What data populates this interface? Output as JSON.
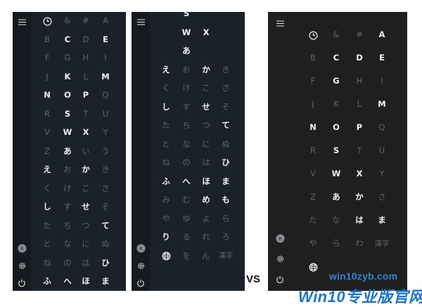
{
  "panels": [
    {
      "name": "panel-left",
      "bg": "#1b2129",
      "rail": "#151a21",
      "rail_icons": [
        {
          "name": "hamburger-menu-icon",
          "slot": "top"
        },
        {
          "name": "user-avatar-icon",
          "slot": "b3"
        },
        {
          "name": "settings-gear-icon",
          "slot": "b2"
        },
        {
          "name": "power-icon",
          "slot": "b1"
        }
      ],
      "rows": [
        [
          [
            "clock",
            1
          ],
          [
            "&",
            0
          ],
          [
            "#",
            0
          ],
          [
            "A",
            0
          ]
        ],
        [
          [
            "B",
            0
          ],
          [
            "C",
            1
          ],
          [
            "D",
            0
          ],
          [
            "E",
            1
          ]
        ],
        [
          [
            "F",
            0
          ],
          [
            "G",
            0
          ],
          [
            "H",
            0
          ],
          [
            "I",
            0
          ]
        ],
        [
          [
            "J",
            0
          ],
          [
            "K",
            1
          ],
          [
            "L",
            0
          ],
          [
            "M",
            1
          ]
        ],
        [
          [
            "N",
            1
          ],
          [
            "O",
            1
          ],
          [
            "P",
            1
          ],
          [
            "Q",
            0
          ]
        ],
        [
          [
            "R",
            0
          ],
          [
            "S",
            1
          ],
          [
            "T",
            0
          ],
          [
            "U",
            0
          ]
        ],
        [
          [
            "V",
            0
          ],
          [
            "W",
            1
          ],
          [
            "X",
            1
          ],
          [
            "Y",
            0
          ]
        ],
        [
          [
            "Z",
            0
          ],
          [
            "あ",
            1
          ],
          [
            "い",
            0
          ],
          [
            "う",
            0
          ]
        ],
        [
          [
            "え",
            1
          ],
          [
            "お",
            0
          ],
          [
            "か",
            1
          ],
          [
            "き",
            0
          ]
        ],
        [
          [
            "く",
            0
          ],
          [
            "け",
            0
          ],
          [
            "こ",
            0
          ],
          [
            "さ",
            0
          ]
        ],
        [
          [
            "し",
            1
          ],
          [
            "す",
            0
          ],
          [
            "せ",
            1
          ],
          [
            "そ",
            0
          ]
        ],
        [
          [
            "た",
            0
          ],
          [
            "ち",
            0
          ],
          [
            "つ",
            0
          ],
          [
            "て",
            1
          ]
        ],
        [
          [
            "と",
            0
          ],
          [
            "な",
            0
          ],
          [
            "に",
            0
          ],
          [
            "ぬ",
            0
          ]
        ],
        [
          [
            "ね",
            0
          ],
          [
            "の",
            0
          ],
          [
            "は",
            0
          ],
          [
            "ひ",
            1
          ]
        ],
        [
          [
            "ふ",
            1
          ],
          [
            "へ",
            1
          ],
          [
            "ほ",
            1
          ],
          [
            "ま",
            1
          ]
        ]
      ]
    },
    {
      "name": "panel-middle",
      "bg": "#1b2129",
      "rail": "#151a21",
      "rail_icons": [
        {
          "name": "hamburger-menu-icon",
          "slot": "top"
        },
        {
          "name": "user-avatar-icon",
          "slot": "b3"
        },
        {
          "name": "settings-gear-icon",
          "slot": "b2"
        },
        {
          "name": "power-icon",
          "slot": "b1"
        }
      ],
      "rows": [
        [
          [
            "",
            0
          ],
          [
            "S",
            1
          ],
          [
            "",
            0
          ],
          [
            "",
            0
          ]
        ],
        [
          [
            "",
            0
          ],
          [
            "W",
            1
          ],
          [
            "X",
            1
          ],
          [
            "",
            0
          ]
        ],
        [
          [
            "",
            0
          ],
          [
            "あ",
            1
          ],
          [
            "",
            0
          ],
          [
            "",
            0
          ]
        ],
        [
          [
            "え",
            1
          ],
          [
            "お",
            0
          ],
          [
            "か",
            1
          ],
          [
            "き",
            0
          ]
        ],
        [
          [
            "く",
            0
          ],
          [
            "け",
            0
          ],
          [
            "こ",
            0
          ],
          [
            "さ",
            0
          ]
        ],
        [
          [
            "し",
            1
          ],
          [
            "す",
            0
          ],
          [
            "せ",
            1
          ],
          [
            "そ",
            0
          ]
        ],
        [
          [
            "た",
            0
          ],
          [
            "ち",
            0
          ],
          [
            "つ",
            0
          ],
          [
            "て",
            1
          ]
        ],
        [
          [
            "と",
            0
          ],
          [
            "な",
            0
          ],
          [
            "に",
            0
          ],
          [
            "ぬ",
            0
          ]
        ],
        [
          [
            "ね",
            0
          ],
          [
            "の",
            0
          ],
          [
            "は",
            0
          ],
          [
            "ひ",
            1
          ]
        ],
        [
          [
            "ふ",
            1
          ],
          [
            "へ",
            1
          ],
          [
            "ほ",
            1
          ],
          [
            "ま",
            1
          ]
        ],
        [
          [
            "み",
            0
          ],
          [
            "む",
            0
          ],
          [
            "め",
            1
          ],
          [
            "も",
            1
          ]
        ],
        [
          [
            "や",
            0
          ],
          [
            "ゆ",
            0
          ],
          [
            "よ",
            0
          ],
          [
            "ら",
            0
          ]
        ],
        [
          [
            "り",
            1
          ],
          [
            "る",
            0
          ],
          [
            "れ",
            0
          ],
          [
            "ろ",
            0
          ]
        ],
        [
          [
            "globe",
            1
          ],
          [
            "を",
            0
          ],
          [
            "ん",
            0
          ],
          [
            "漢字",
            0
          ]
        ]
      ]
    },
    {
      "name": "panel-right",
      "bg": "#1f1f1f",
      "rail": "#1f1f1f",
      "rail_icons": [
        {
          "name": "hamburger-menu-icon",
          "slot": "top"
        },
        {
          "name": "user-avatar-icon",
          "slot": "b3"
        },
        {
          "name": "settings-gear-icon",
          "slot": "b2"
        },
        {
          "name": "power-icon",
          "slot": "b1"
        }
      ],
      "rows": [
        [
          [
            "clock",
            1
          ],
          [
            "&",
            0
          ],
          [
            "#",
            0
          ],
          [
            "A",
            1
          ]
        ],
        [
          [
            "B",
            0
          ],
          [
            "C",
            1
          ],
          [
            "D",
            1
          ],
          [
            "E",
            1
          ]
        ],
        [
          [
            "F",
            0
          ],
          [
            "G",
            1
          ],
          [
            "H",
            0
          ],
          [
            "I",
            0
          ]
        ],
        [
          [
            "J",
            0
          ],
          [
            "K",
            0
          ],
          [
            "L",
            0
          ],
          [
            "M",
            1
          ]
        ],
        [
          [
            "N",
            1
          ],
          [
            "O",
            1
          ],
          [
            "P",
            1
          ],
          [
            "Q",
            0
          ]
        ],
        [
          [
            "R",
            0
          ],
          [
            "S",
            1
          ],
          [
            "T",
            0
          ],
          [
            "U",
            0
          ]
        ],
        [
          [
            "V",
            0
          ],
          [
            "W",
            1
          ],
          [
            "X",
            1
          ],
          [
            "Y",
            0
          ]
        ],
        [
          [
            "Z",
            0
          ],
          [
            "あ",
            1
          ],
          [
            "か",
            1
          ],
          [
            "さ",
            0
          ]
        ],
        [
          [
            "た",
            0
          ],
          [
            "な",
            0
          ],
          [
            "は",
            1
          ],
          [
            "ま",
            1
          ]
        ],
        [
          [
            "や",
            0
          ],
          [
            "ら",
            0
          ],
          [
            "わ",
            0
          ],
          [
            "漢字",
            0
          ]
        ],
        [
          [
            "globe",
            1
          ],
          [
            "",
            0
          ],
          [
            "",
            0
          ],
          [
            "",
            0
          ]
        ]
      ]
    }
  ],
  "vs_label": "VS",
  "watermark": {
    "top": "win10zyb.com",
    "main": "Win10专业版官网"
  }
}
